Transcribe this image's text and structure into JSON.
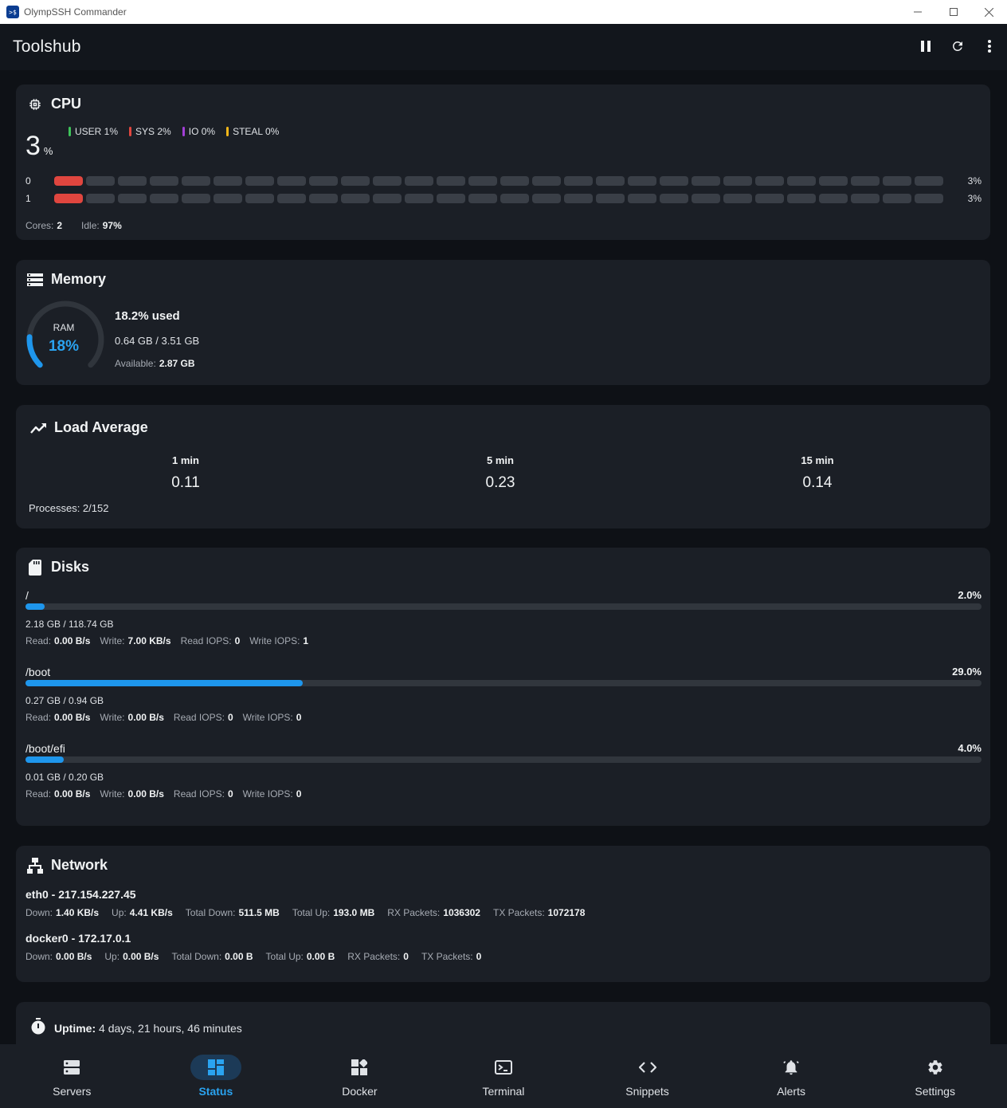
{
  "window": {
    "title": "OlympSSH Commander",
    "icon_text": ">$"
  },
  "header": {
    "title": "Toolshub",
    "actions": [
      "pause-icon",
      "refresh-icon",
      "more-vert-icon"
    ]
  },
  "cpu": {
    "title": "CPU",
    "total": "3",
    "unit": "%",
    "legend": [
      {
        "label": "USER 1%",
        "color": "#3ec35a"
      },
      {
        "label": "SYS 2%",
        "color": "#e0463f"
      },
      {
        "label": "IO 0%",
        "color": "#a23fd6"
      },
      {
        "label": "STEAL 0%",
        "color": "#f2b619"
      }
    ],
    "cores": [
      {
        "id": "0",
        "value": "3%",
        "load": 0.03
      },
      {
        "id": "1",
        "value": "3%",
        "load": 0.03
      }
    ],
    "cores_label": "Cores:",
    "cores_value": "2",
    "idle_label": "Idle:",
    "idle_value": "97%"
  },
  "memory": {
    "title": "Memory",
    "gauge_label": "RAM",
    "gauge_value": "18%",
    "used_fraction": 0.182,
    "used_text": "18.2% used",
    "size_text": "0.64 GB / 3.51 GB",
    "available_label": "Available:",
    "available_value": "2.87 GB",
    "accent": "#2aa3f0"
  },
  "load": {
    "title": "Load Average",
    "columns": [
      {
        "label": "1 min",
        "value": "0.11"
      },
      {
        "label": "5 min",
        "value": "0.23"
      },
      {
        "label": "15 min",
        "value": "0.14"
      }
    ],
    "processes": "Processes: 2/152"
  },
  "disks": {
    "title": "Disks",
    "items": [
      {
        "mount": "/",
        "percent": "2.0%",
        "fill": 0.02,
        "size": "2.18 GB / 118.74 GB",
        "read_label": "Read:",
        "read": "0.00 B/s",
        "write_label": "Write:",
        "write": "7.00 KB/s",
        "riops_label": "Read IOPS:",
        "riops": "0",
        "wiops_label": "Write IOPS:",
        "wiops": "1"
      },
      {
        "mount": "/boot",
        "percent": "29.0%",
        "fill": 0.29,
        "size": "0.27 GB / 0.94 GB",
        "read_label": "Read:",
        "read": "0.00 B/s",
        "write_label": "Write:",
        "write": "0.00 B/s",
        "riops_label": "Read IOPS:",
        "riops": "0",
        "wiops_label": "Write IOPS:",
        "wiops": "0"
      },
      {
        "mount": "/boot/efi",
        "percent": "4.0%",
        "fill": 0.04,
        "size": "0.01 GB / 0.20 GB",
        "read_label": "Read:",
        "read": "0.00 B/s",
        "write_label": "Write:",
        "write": "0.00 B/s",
        "riops_label": "Read IOPS:",
        "riops": "0",
        "wiops_label": "Write IOPS:",
        "wiops": "0"
      }
    ]
  },
  "network": {
    "title": "Network",
    "interfaces": [
      {
        "name": "eth0 - 217.154.227.45",
        "down_label": "Down:",
        "down": "1.40 KB/s",
        "up_label": "Up:",
        "up": "4.41 KB/s",
        "tdown_label": "Total Down:",
        "tdown": "511.5 MB",
        "tup_label": "Total Up:",
        "tup": "193.0 MB",
        "rx_label": "RX Packets:",
        "rx": "1036302",
        "tx_label": "TX Packets:",
        "tx": "1072178"
      },
      {
        "name": "docker0 - 172.17.0.1",
        "down_label": "Down:",
        "down": "0.00 B/s",
        "up_label": "Up:",
        "up": "0.00 B/s",
        "tdown_label": "Total Down:",
        "tdown": "0.00 B",
        "tup_label": "Total Up:",
        "tup": "0.00 B",
        "rx_label": "RX Packets:",
        "rx": "0",
        "tx_label": "TX Packets:",
        "tx": "0"
      }
    ]
  },
  "uptime": {
    "label": "Uptime:",
    "value": "4 days, 21 hours, 46 minutes"
  },
  "nav": {
    "items": [
      {
        "label": "Servers",
        "icon": "servers-icon"
      },
      {
        "label": "Status",
        "icon": "dashboard-icon",
        "active": true
      },
      {
        "label": "Docker",
        "icon": "docker-icon"
      },
      {
        "label": "Terminal",
        "icon": "terminal-icon"
      },
      {
        "label": "Snippets",
        "icon": "code-icon"
      },
      {
        "label": "Alerts",
        "icon": "bell-icon"
      },
      {
        "label": "Settings",
        "icon": "gear-icon"
      }
    ]
  }
}
